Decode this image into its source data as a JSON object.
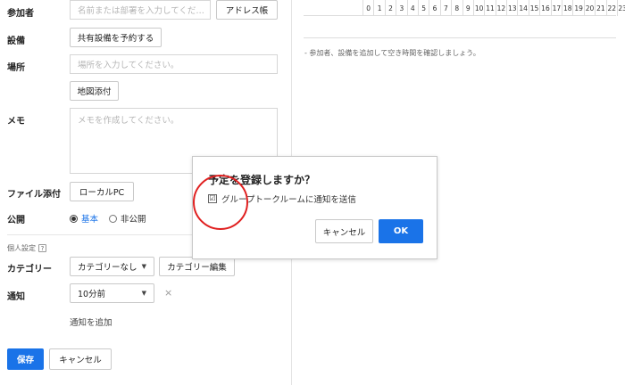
{
  "form": {
    "participants": {
      "label": "参加者",
      "placeholder": "名前または部署を入力してくだ…",
      "address_book_button": "アドレス帳"
    },
    "facility": {
      "label": "設備",
      "reserve_button": "共有設備を予約する"
    },
    "location": {
      "label": "場所",
      "placeholder": "場所を入力してください。",
      "map_button": "地図添付"
    },
    "memo": {
      "label": "メモ",
      "placeholder": "メモを作成してください。"
    },
    "attachment": {
      "label": "ファイル添付",
      "local_pc_button": "ローカルPC"
    },
    "visibility": {
      "label": "公開",
      "options": [
        "基本",
        "非公開"
      ],
      "selected": "基本"
    },
    "personal_settings": {
      "label": "個人設定",
      "help": "?"
    },
    "category": {
      "label": "カテゴリー",
      "selected": "カテゴリーなし",
      "edit_button": "カテゴリー編集"
    },
    "notification": {
      "label": "通知",
      "selected": "10分前",
      "remove": "×",
      "add_link": "通知を追加"
    },
    "actions": {
      "save": "保存",
      "cancel": "キャンセル"
    }
  },
  "timeline": {
    "hours": [
      "0",
      "1",
      "2",
      "3",
      "4",
      "5",
      "6",
      "7",
      "8",
      "9",
      "10",
      "11",
      "12",
      "13",
      "14",
      "15",
      "16",
      "17",
      "18",
      "19",
      "20",
      "21",
      "22",
      "23"
    ],
    "hint": "- 参加者、設備を追加して空き時間を確認しましょう。"
  },
  "dialog": {
    "title": "予定を登録しますか？",
    "checkbox_label": "グループトークルームに通知を送信",
    "checkbox_mark": "☑",
    "checked": true,
    "cancel": "キャンセル",
    "ok": "OK"
  },
  "colors": {
    "primary": "#1a73e8",
    "annotation": "#e02020"
  }
}
